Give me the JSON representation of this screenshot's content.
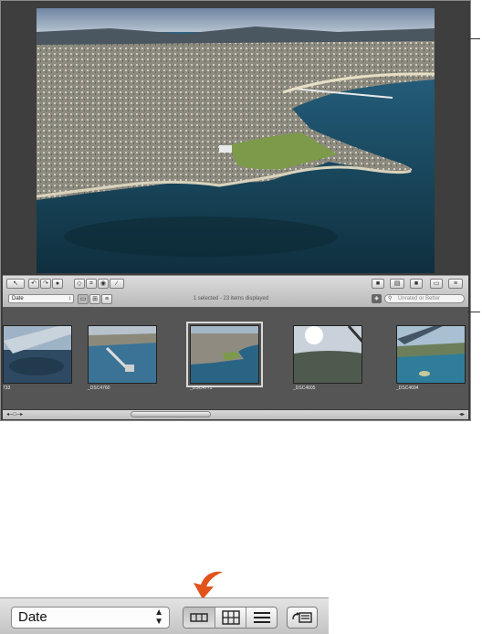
{
  "toolbar": {
    "sort_value": "Date",
    "status": "1 selected - 23 items displayed",
    "filter_placeholder": "Unrated or Better"
  },
  "thumbnails": [
    {
      "caption": "733"
    },
    {
      "caption": "_DSC4760"
    },
    {
      "caption": "_DSC4771"
    },
    {
      "caption": "_DSC4605"
    },
    {
      "caption": "_DSC4694"
    }
  ],
  "zoomed": {
    "sort_value": "Date"
  },
  "icons": {
    "tools": [
      "select-arrow-icon",
      "rotate-left-icon",
      "rotate-right-icon",
      "straighten-icon",
      "crop-icon",
      "red-eye-icon",
      "retouch-brush-icon"
    ],
    "right_tools": [
      "flag-icon",
      "stack-icon",
      "label-icon",
      "viewer-icon",
      "browser-icon"
    ],
    "view_modes": [
      "filmstrip-view-icon",
      "grid-view-icon",
      "list-view-icon"
    ]
  },
  "colors": {
    "accent_arrow": "#e2531c",
    "window_bg": "#3c3c3c",
    "browser_bg": "#555555"
  }
}
